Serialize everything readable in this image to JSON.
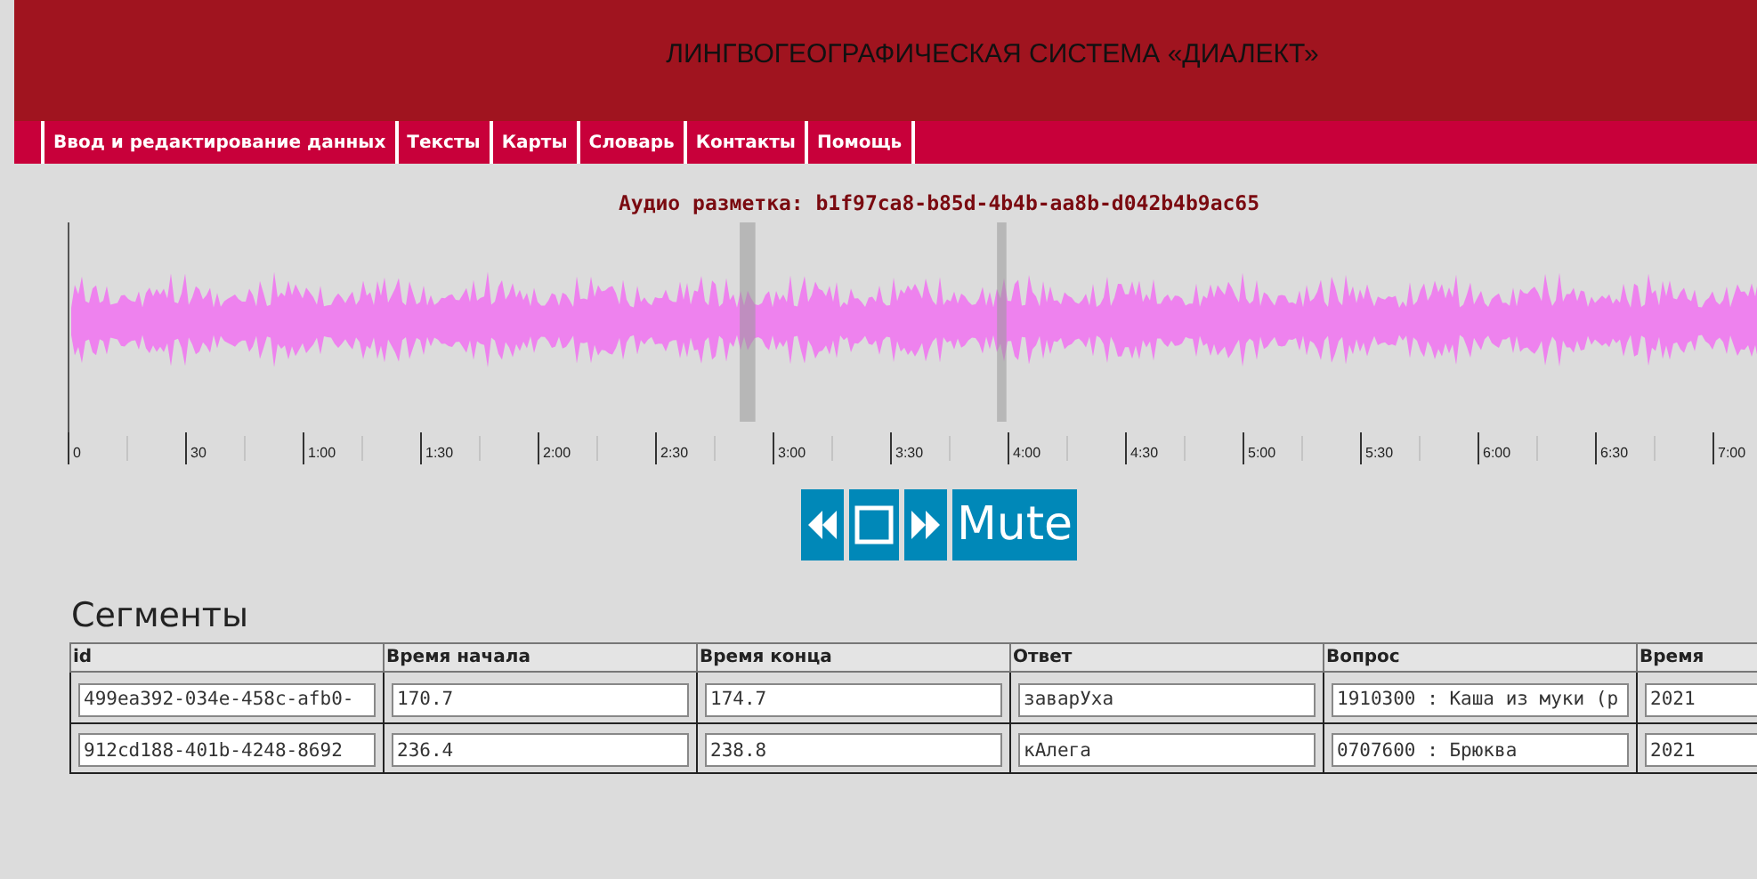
{
  "header": {
    "title": "ЛИНГВОГЕОГРАФИЧЕСКАЯ СИСТЕМА «ДИАЛЕКТ»"
  },
  "nav": [
    {
      "label": "Ввод и редактирование данных"
    },
    {
      "label": "Тексты"
    },
    {
      "label": "Карты"
    },
    {
      "label": "Словарь"
    },
    {
      "label": "Контакты"
    },
    {
      "label": "Помощь"
    }
  ],
  "audio": {
    "title": "Аудио разметка: b1f97ca8-b85d-4b4b-aa8b-d042b4b9ac65",
    "timeline": [
      "0",
      "30",
      "1:00",
      "1:30",
      "2:00",
      "2:30",
      "3:00",
      "3:30",
      "4:00",
      "4:30",
      "5:00",
      "5:30",
      "6:00",
      "6:30",
      "7:00"
    ],
    "controls": [
      {
        "kind": "rewind"
      },
      {
        "kind": "stop"
      },
      {
        "kind": "forward"
      },
      {
        "kind": "text",
        "label": "Mute"
      }
    ]
  },
  "segments": {
    "title": "Сегменты",
    "columns": [
      "id",
      "Время начала",
      "Время конца",
      "Ответ",
      "Вопрос",
      "Время"
    ],
    "rows": [
      [
        "499ea392-034e-458c-afb0-",
        "170.7",
        "174.7",
        "заварУха",
        "1910300 : Каша из муки (р",
        "2021"
      ],
      [
        "912cd188-401b-4248-8692",
        "236.4",
        "238.8",
        "кАлега",
        "0707600 : Брюква",
        "2021"
      ]
    ]
  }
}
